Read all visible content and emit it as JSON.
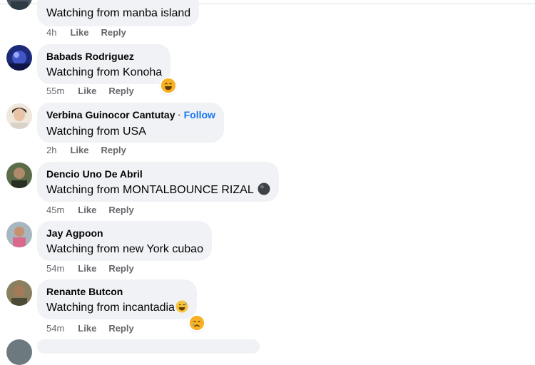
{
  "comments": [
    {
      "author": "",
      "text": "Watching from manba island",
      "time": "4h",
      "like": "Like",
      "reply": "Reply"
    },
    {
      "author": "Babads Rodriguez",
      "text": "Watching from Konoha",
      "time": "55m",
      "like": "Like",
      "reply": "Reply",
      "reaction_icon": "laughing-face-icon"
    },
    {
      "author": "Verbina Guinocor Cantutay",
      "follow_separator": "·",
      "follow": "Follow",
      "text": "Watching from USA",
      "time": "2h",
      "like": "Like",
      "reply": "Reply"
    },
    {
      "author": "Dencio Uno De Abril",
      "text": "Watching from MONTALBOUNCE RIZAL",
      "text_emoji_icon": "black-circle-icon",
      "time": "45m",
      "like": "Like",
      "reply": "Reply"
    },
    {
      "author": "Jay Agpoon",
      "text": "Watching from new York cubao",
      "time": "54m",
      "like": "Like",
      "reply": "Reply"
    },
    {
      "author": "Renante Butcon",
      "text": "Watching from incantadia",
      "text_emoji_icon": "grinning-sweat-face-icon",
      "time": "54m",
      "like": "Like",
      "reply": "Reply",
      "reaction_icon": "crying-face-icon"
    }
  ],
  "colors": {
    "bubble": "#f0f2f5",
    "meta_text": "#65676b",
    "follow": "#1877f2",
    "reaction_yellow": "#f7b125"
  }
}
